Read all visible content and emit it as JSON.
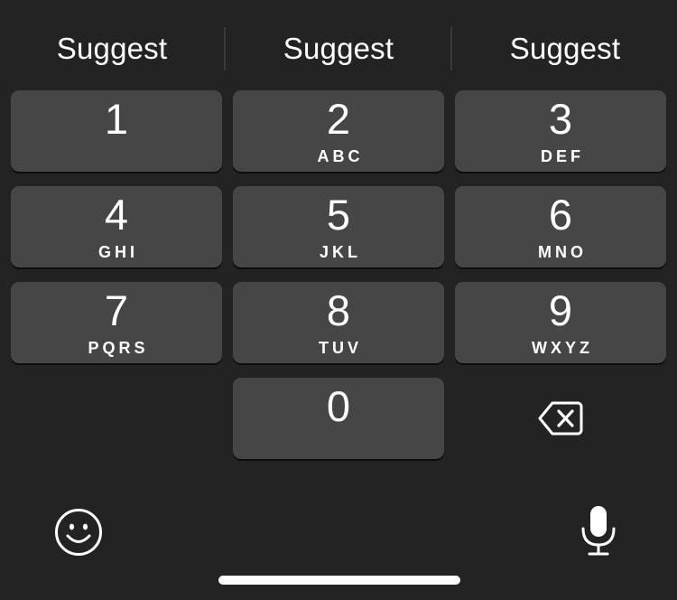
{
  "suggestions": [
    "Suggest",
    "Suggest",
    "Suggest"
  ],
  "keys": [
    {
      "digit": "1",
      "letters": ""
    },
    {
      "digit": "2",
      "letters": "ABC"
    },
    {
      "digit": "3",
      "letters": "DEF"
    },
    {
      "digit": "4",
      "letters": "GHI"
    },
    {
      "digit": "5",
      "letters": "JKL"
    },
    {
      "digit": "6",
      "letters": "MNO"
    },
    {
      "digit": "7",
      "letters": "PQRS"
    },
    {
      "digit": "8",
      "letters": "TUV"
    },
    {
      "digit": "9",
      "letters": "WXYZ"
    },
    {
      "digit": "0",
      "letters": ""
    }
  ],
  "icons": {
    "backspace": "backspace-icon",
    "emoji": "emoji-icon",
    "mic": "microphone-icon"
  },
  "colors": {
    "background": "#232323",
    "key": "#464646",
    "text": "#ffffff"
  }
}
